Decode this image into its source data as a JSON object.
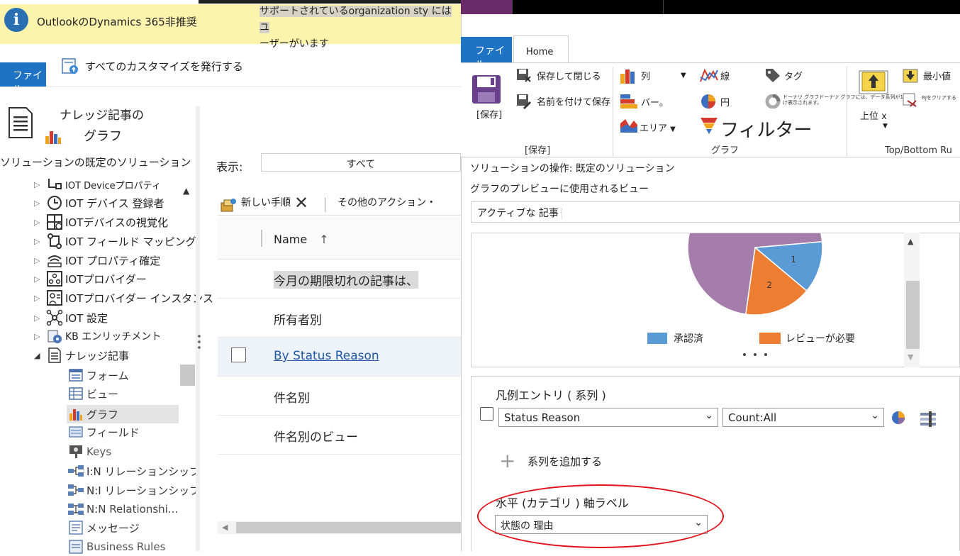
{
  "notification": {
    "title": "OutlookのDynamics 365非推奨",
    "message_line1": "サポートされているorganization sty にはユ",
    "message_line2": "ーザーがいます"
  },
  "left_window": {
    "file_tab": "ファイル",
    "publish_all": "すべてのカスタマイズを発行する",
    "entity_title": "ナレッジ記事の",
    "section_title": "グラフ",
    "solution_label": "ソリューションの既定のソリューション",
    "tree": [
      {
        "label": "IOT Deviceプロパティ",
        "icon": "device-property-icon"
      },
      {
        "label": "IOT デバイス 登録者",
        "icon": "history-icon"
      },
      {
        "label": "IOTデバイスの視覚化",
        "icon": "visualization-icon"
      },
      {
        "label": "IOT フィールド マッピング",
        "icon": "mapping-icon"
      },
      {
        "label": "IOT プロパティ確定",
        "icon": "property-confirm-icon"
      },
      {
        "label": "IOTプロバイダー",
        "icon": "provider-icon"
      },
      {
        "label": "IOTプロバイダー インスタンス",
        "icon": "provider-instance-icon"
      },
      {
        "label": "IOT 設定",
        "icon": "settings-icon"
      },
      {
        "label": "KB エンリッチメント",
        "icon": "kb-enrichment-icon"
      },
      {
        "label": "ナレッジ記事",
        "icon": "document-icon"
      }
    ],
    "subtree": [
      {
        "label": "フォーム",
        "icon": "form-icon"
      },
      {
        "label": "ビュー",
        "icon": "view-icon"
      },
      {
        "label": "グラフ",
        "icon": "chart-icon"
      },
      {
        "label": "フィールド",
        "icon": "field-icon"
      },
      {
        "label": "Keys",
        "icon": "key-icon"
      },
      {
        "label": "I:N リレーションシップ",
        "icon": "relationship-1n-icon"
      },
      {
        "label": "N:I リレーションシップ",
        "icon": "relationship-n1-icon"
      },
      {
        "label": "N:N Relationshi...",
        "icon": "relationship-nn-icon"
      },
      {
        "label": "メッセージ",
        "icon": "message-icon"
      },
      {
        "label": "Business Rules",
        "icon": "business-rules-icon"
      }
    ],
    "view_label": "表示:",
    "view_value": "すべて",
    "cmd_new": "新しい手順",
    "cmd_other": "その他のアクション・",
    "grid_header": "Name",
    "grid_rows": [
      "今月の期限切れの記事は、",
      "所有者別",
      "By Status Reason",
      "件名別",
      "件名別のビュー"
    ]
  },
  "dialog": {
    "tab_file": "ファイル",
    "tab_home": "Home",
    "save": "[保存]",
    "save_close": "保存して閉じる",
    "save_as": "名前を付けて保存",
    "group_save": "[保存]",
    "column": "列",
    "bar": "バー。",
    "area": "エリア",
    "line": "線",
    "pie": "円",
    "filter": "フィルター",
    "tag": "タグ",
    "donut_text": "ドーナツ グラフドーナツ グラフには、データ系列が1つだけ表示されます。",
    "group_chart": "グラフ",
    "top_x": "上位 x",
    "min_value": "最小値",
    "rj": "RJをクリアする",
    "group_topbottom": "Top/Bottom Ru",
    "solution_ops": "ソリューションの操作: 既定のソリューション",
    "preview_view_label": "グラフのプレビューに使用されるビュー",
    "preview_view_value": "アクティブな 記事",
    "legend_entry_label": "凡例エントリ ( 系列 )",
    "series_field": "Status Reason",
    "series_aggregate": "Count:All",
    "add_series": "系列を追加する",
    "horizontal_label": "水平 (カテゴリ ) 軸ラベル",
    "horizontal_value": "状態の 理由"
  },
  "chart_data": {
    "type": "pie",
    "slices": [
      {
        "label": "1",
        "color": "#5b9bd5",
        "name": "承認済"
      },
      {
        "label": "2",
        "color": "#ed7d31",
        "name": "レビューが必要"
      },
      {
        "label": "",
        "color": "#a47dab",
        "name": ""
      }
    ],
    "legend": [
      "承認済",
      "レビューが必要"
    ],
    "colors": {
      "approved": "#5b9bd5",
      "review": "#ed7d31",
      "other": "#a47dab"
    }
  },
  "annotation": {
    "color": "#e3121a"
  }
}
